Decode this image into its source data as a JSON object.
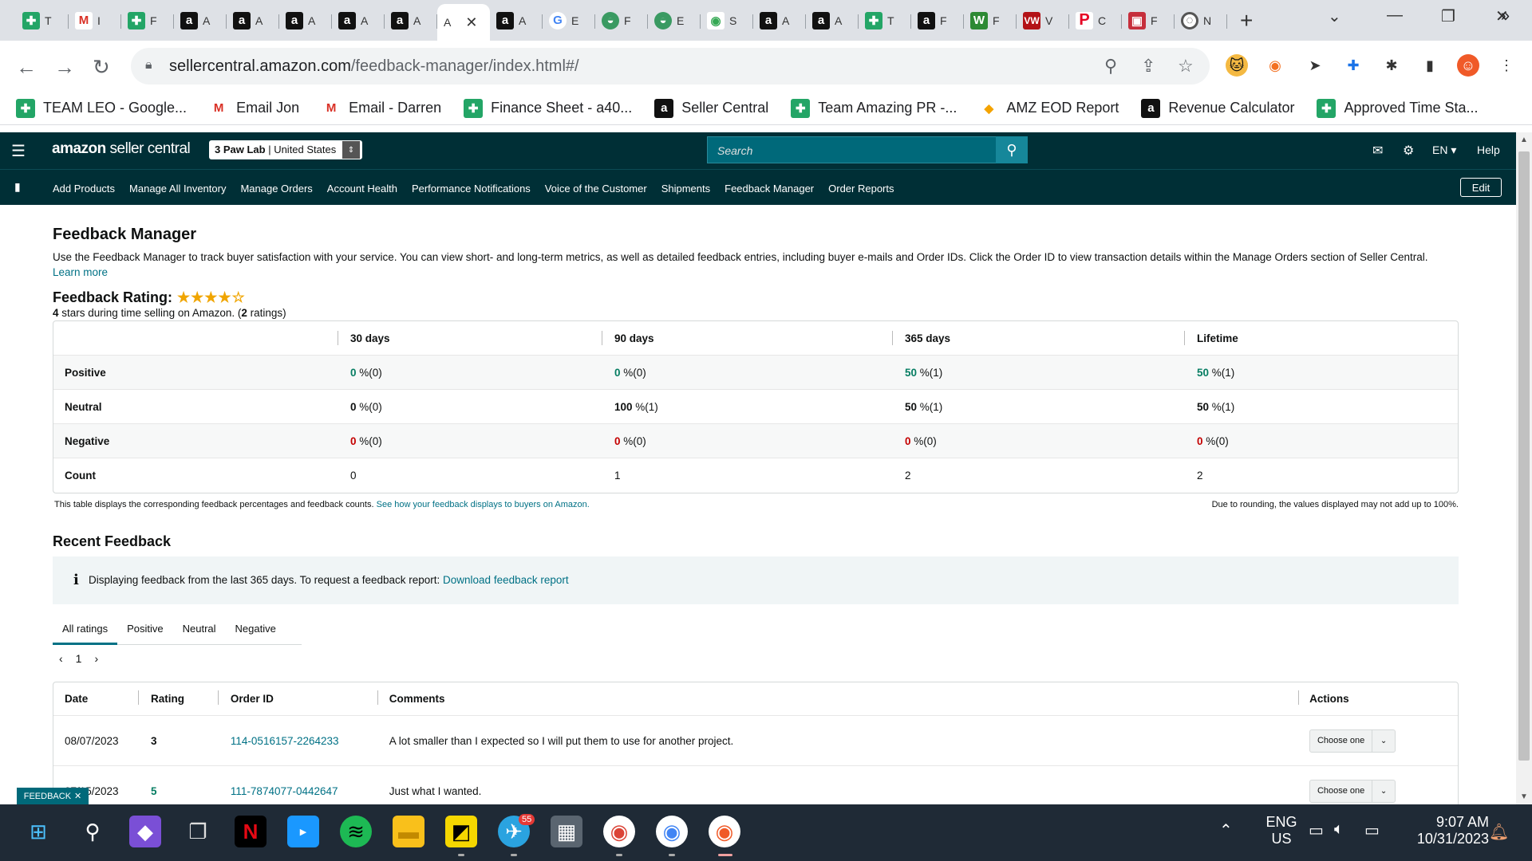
{
  "browser": {
    "tabs": [
      {
        "icon": "sheets",
        "text": "T"
      },
      {
        "icon": "gmail",
        "text": "I"
      },
      {
        "icon": "sheets",
        "text": "F"
      },
      {
        "icon": "amz",
        "text": "A"
      },
      {
        "icon": "amz",
        "text": "A"
      },
      {
        "icon": "amz",
        "text": "A"
      },
      {
        "icon": "amz",
        "text": "A"
      },
      {
        "icon": "amz",
        "text": "A"
      }
    ],
    "active_tab_text": "A",
    "tabs_right": [
      {
        "icon": "amz",
        "text": "A"
      },
      {
        "icon": "google",
        "text": "E"
      },
      {
        "icon": "green",
        "text": "F"
      },
      {
        "icon": "green",
        "text": "E"
      },
      {
        "icon": "maps",
        "text": "S"
      },
      {
        "icon": "amz",
        "text": "A"
      },
      {
        "icon": "amz",
        "text": "A"
      },
      {
        "icon": "sheets",
        "text": "T"
      },
      {
        "icon": "amz",
        "text": "F"
      },
      {
        "icon": "w",
        "text": "F"
      },
      {
        "icon": "vw",
        "text": "V"
      },
      {
        "icon": "p",
        "text": "C"
      },
      {
        "icon": "red2",
        "text": "F"
      },
      {
        "icon": "gh",
        "text": "N"
      }
    ],
    "url_domain": "sellercentral.amazon.com",
    "url_path": "/feedback-manager/index.html#/",
    "bookmarks": [
      {
        "icon": "sheets",
        "label": "TEAM LEO - Google..."
      },
      {
        "icon": "gmail",
        "label": "Email Jon"
      },
      {
        "icon": "gmail",
        "label": "Email - Darren"
      },
      {
        "icon": "sheets",
        "label": "Finance Sheet - a40..."
      },
      {
        "icon": "amz",
        "label": "Seller Central"
      },
      {
        "icon": "sheets",
        "label": "Team Amazing PR -..."
      },
      {
        "icon": "diamond",
        "label": "AMZ EOD Report"
      },
      {
        "icon": "amz",
        "label": "Revenue Calculator"
      },
      {
        "icon": "sheets",
        "label": "Approved Time Sta..."
      }
    ]
  },
  "header": {
    "logo_bold": "amazon",
    "logo_light": " seller central",
    "store_name": "3 Paw Lab",
    "store_region": "United States",
    "search_placeholder": "Search",
    "language": "EN",
    "help": "Help"
  },
  "nav": {
    "links": [
      "Add Products",
      "Manage All Inventory",
      "Manage Orders",
      "Account Health",
      "Performance Notifications",
      "Voice of the Customer",
      "Shipments",
      "Feedback Manager",
      "Order Reports"
    ],
    "edit": "Edit"
  },
  "page": {
    "title": "Feedback Manager",
    "intro": "Use the Feedback Manager to track buyer satisfaction with your service. You can view short- and long-term metrics, as well as detailed feedback entries, including buyer e-mails and Order IDs. Click the Order ID to view transaction details within the Manage Orders section of Seller Central.",
    "learn_more": "Learn more",
    "rating_label": "Feedback Rating:",
    "stars_filled": 4,
    "stars_total": 5,
    "rating_stars_num": "4",
    "rating_sub_mid": " stars during time selling on Amazon. (",
    "rating_count": "2",
    "rating_sub_end": " ratings)"
  },
  "metrics": {
    "columns": [
      "",
      "30 days",
      "90 days",
      "365 days",
      "Lifetime"
    ],
    "rows": [
      {
        "label": "Positive",
        "cells": [
          {
            "num": "0",
            "rest": " %(0)",
            "style": "pos"
          },
          {
            "num": "0",
            "rest": " %(0)",
            "style": "pos"
          },
          {
            "num": "50",
            "rest": " %(1)",
            "style": "pos"
          },
          {
            "num": "50",
            "rest": " %(1)",
            "style": "pos"
          }
        ]
      },
      {
        "label": "Neutral",
        "cells": [
          {
            "num": "0",
            "rest": " %(0)",
            "style": "bold"
          },
          {
            "num": "100",
            "rest": " %(1)",
            "style": "bold"
          },
          {
            "num": "50",
            "rest": " %(1)",
            "style": "bold"
          },
          {
            "num": "50",
            "rest": " %(1)",
            "style": "bold"
          }
        ]
      },
      {
        "label": "Negative",
        "cells": [
          {
            "num": "0",
            "rest": " %(0)",
            "style": "neg"
          },
          {
            "num": "0",
            "rest": " %(0)",
            "style": "neg"
          },
          {
            "num": "0",
            "rest": " %(0)",
            "style": "neg"
          },
          {
            "num": "0",
            "rest": " %(0)",
            "style": "neg"
          }
        ]
      },
      {
        "label": "Count",
        "cells": [
          {
            "num": "0",
            "rest": "",
            "style": ""
          },
          {
            "num": "1",
            "rest": "",
            "style": ""
          },
          {
            "num": "2",
            "rest": "",
            "style": ""
          },
          {
            "num": "2",
            "rest": "",
            "style": ""
          }
        ]
      }
    ],
    "note_left": "This table displays the corresponding feedback percentages and feedback counts.",
    "note_left_link": "See how your feedback displays to buyers on Amazon.",
    "note_right": "Due to rounding, the values displayed may not add up to 100%."
  },
  "recent": {
    "title": "Recent Feedback",
    "info_text": "Displaying feedback from the last 365 days. To request a feedback report:",
    "info_link": "Download feedback report",
    "tabs": [
      "All ratings",
      "Positive",
      "Neutral",
      "Negative"
    ],
    "page": "1",
    "columns": [
      "Date",
      "Rating",
      "Order ID",
      "Comments",
      "Actions"
    ],
    "rows": [
      {
        "date": "08/07/2023",
        "rating": "3",
        "rating_style": "",
        "order_id": "114-0516157-2264233",
        "comment": "A lot smaller than I expected so I will put them to use for another project.",
        "action": "Choose one"
      },
      {
        "date": "07/15/2023",
        "rating": "5",
        "rating_style": "pos",
        "order_id": "111-7874077-0442647",
        "comment": "Just what I wanted.",
        "action": "Choose one"
      }
    ]
  },
  "feedback_tag": "FEEDBACK",
  "taskbar": {
    "lang_top": "ENG",
    "lang_bottom": "US",
    "time": "9:07 AM",
    "date": "10/31/2023",
    "telegram_badge": "55"
  }
}
